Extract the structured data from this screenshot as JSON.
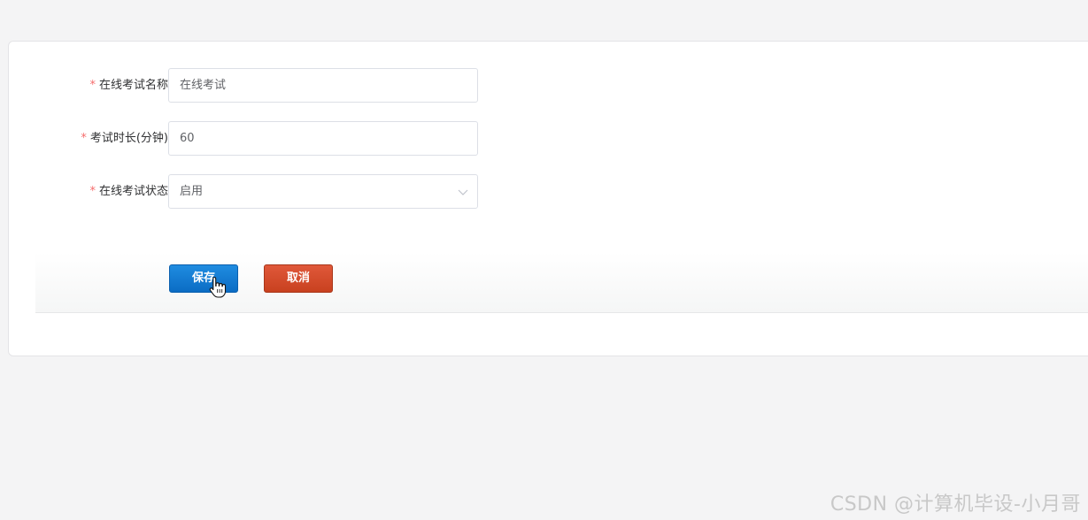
{
  "form": {
    "name": {
      "required_mark": "*",
      "label": "在线考试名称",
      "value": "在线考试"
    },
    "duration": {
      "required_mark": "*",
      "label": "考试时长(分钟)",
      "value": "60"
    },
    "status": {
      "required_mark": "*",
      "label": "在线考试状态",
      "value": "启用",
      "arrow_icon": "chevron-down-icon"
    }
  },
  "actions": {
    "save_label": "保存",
    "cancel_label": "取消",
    "save_color": "#0b6cc4",
    "cancel_color": "#c8411f"
  },
  "cursor_icon": "hand-pointer-icon",
  "watermark": "CSDN @计算机毕设-小月哥"
}
